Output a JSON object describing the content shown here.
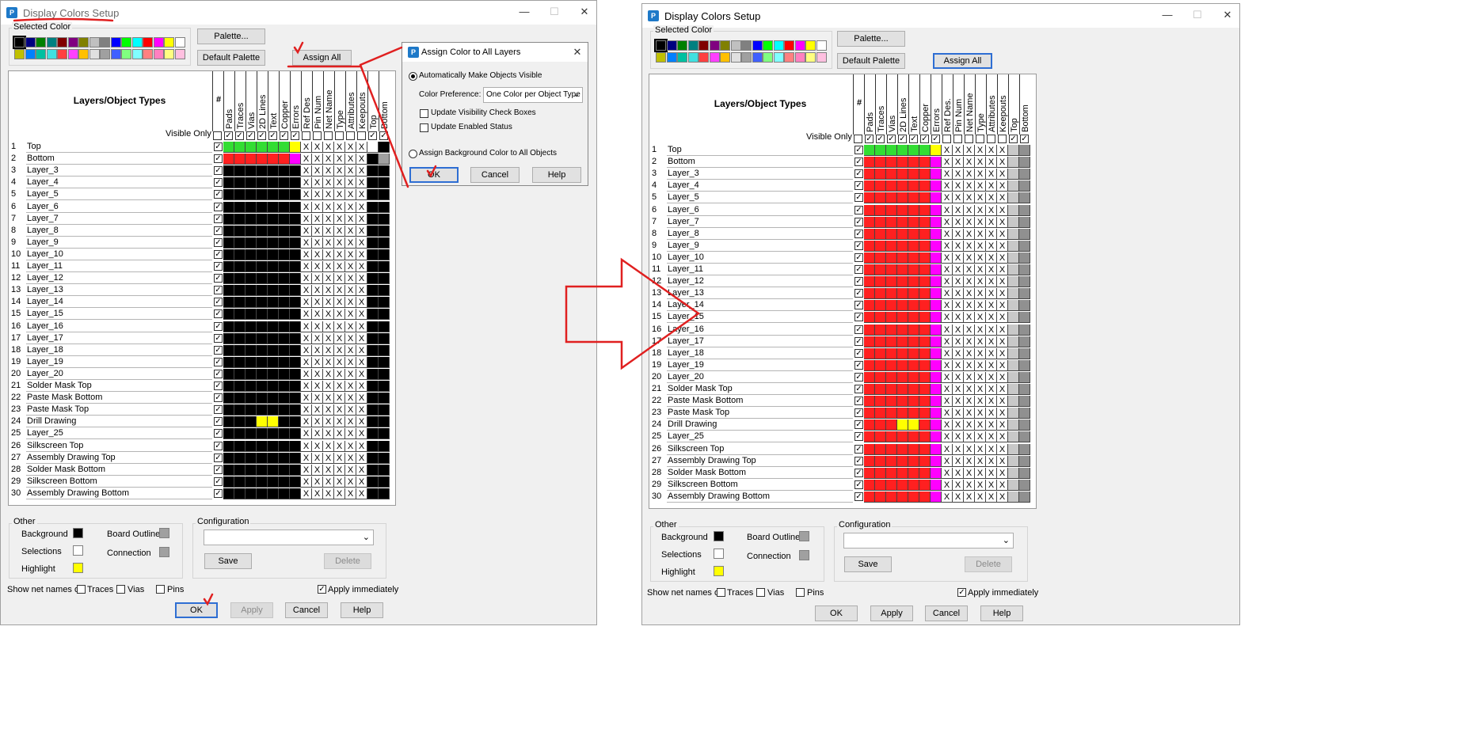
{
  "title": "Display Colors Setup",
  "selected_color_label": "Selected Color",
  "palette_btn": "Palette...",
  "default_palette_btn": "Default Palette",
  "assign_all_btn": "Assign All",
  "grid_header": "Layers/Object Types",
  "hash": "#",
  "visible_only": "Visible Only",
  "columns": [
    "Pads",
    "Traces",
    "Vias",
    "2D Lines",
    "Text",
    "Copper",
    "Errors",
    "Ref Des",
    "Pin Num",
    "Net Name",
    "Type",
    "Attributes",
    "Keepouts",
    "Top",
    "Bottom"
  ],
  "columns_right": [
    "Pads",
    "Traces",
    "Vias",
    "2D Lines",
    "Text",
    "Copper",
    "Errors",
    "Ref Des.",
    "Pin Num",
    "Net Name",
    "Type",
    "Attributes",
    "Keepouts",
    "Top",
    "Bottom"
  ],
  "rows": [
    {
      "n": "1",
      "name": "Top"
    },
    {
      "n": "2",
      "name": "Bottom"
    },
    {
      "n": "3",
      "name": "Layer_3"
    },
    {
      "n": "4",
      "name": "Layer_4"
    },
    {
      "n": "5",
      "name": "Layer_5"
    },
    {
      "n": "6",
      "name": "Layer_6"
    },
    {
      "n": "7",
      "name": "Layer_7"
    },
    {
      "n": "8",
      "name": "Layer_8"
    },
    {
      "n": "9",
      "name": "Layer_9"
    },
    {
      "n": "10",
      "name": "Layer_10"
    },
    {
      "n": "11",
      "name": "Layer_11"
    },
    {
      "n": "12",
      "name": "Layer_12"
    },
    {
      "n": "13",
      "name": "Layer_13"
    },
    {
      "n": "14",
      "name": "Layer_14"
    },
    {
      "n": "15",
      "name": "Layer_15"
    },
    {
      "n": "16",
      "name": "Layer_16"
    },
    {
      "n": "17",
      "name": "Layer_17"
    },
    {
      "n": "18",
      "name": "Layer_18"
    },
    {
      "n": "19",
      "name": "Layer_19"
    },
    {
      "n": "20",
      "name": "Layer_20"
    },
    {
      "n": "21",
      "name": "Solder Mask Top"
    },
    {
      "n": "22",
      "name": "Paste Mask Bottom"
    },
    {
      "n": "23",
      "name": "Paste Mask Top"
    },
    {
      "n": "24",
      "name": "Drill Drawing"
    },
    {
      "n": "25",
      "name": "Layer_25"
    },
    {
      "n": "26",
      "name": "Silkscreen Top"
    },
    {
      "n": "27",
      "name": "Assembly Drawing Top"
    },
    {
      "n": "28",
      "name": "Solder Mask Bottom"
    },
    {
      "n": "29",
      "name": "Silkscreen Bottom"
    },
    {
      "n": "30",
      "name": "Assembly Drawing Bottom"
    }
  ],
  "other": {
    "label": "Other",
    "background": "Background",
    "selections": "Selections",
    "highlight": "Highlight",
    "board_outline": "Board Outline",
    "connection": "Connection"
  },
  "configuration": {
    "label": "Configuration",
    "save": "Save",
    "delete": "Delete"
  },
  "net_names": {
    "label": "Show net names on",
    "traces": "Traces",
    "vias": "Vias",
    "pins": "Pins"
  },
  "apply_immediately": "Apply immediately",
  "footer": {
    "ok": "OK",
    "apply": "Apply",
    "cancel": "Cancel",
    "help": "Help"
  },
  "dialog": {
    "title": "Assign Color to All Layers",
    "auto_visible": "Automatically Make Objects Visible",
    "color_pref_label": "Color Preference:",
    "color_pref_value": "One Color per Object Type",
    "update_visibility": "Update Visibility Check Boxes",
    "update_enabled": "Update Enabled Status",
    "assign_bg": "Assign Background Color to All Objects",
    "ok": "OK",
    "cancel": "Cancel",
    "help": "Help"
  },
  "palette_colors": [
    "#000000",
    "#000080",
    "#008000",
    "#008080",
    "#800000",
    "#800080",
    "#808000",
    "#c0c0c0",
    "#808080",
    "#0000ff",
    "#00ff00",
    "#00ffff",
    "#ff0000",
    "#ff00ff",
    "#ffff00",
    "#ffffff",
    "#c0c000",
    "#0080ff",
    "#00c0a0",
    "#40e0e0",
    "#ff4040",
    "#ff40ff",
    "#ffc000",
    "#e0e0e0",
    "#a0a0a0",
    "#4060ff",
    "#80ff80",
    "#80ffff",
    "#ff8080",
    "#ff80c0",
    "#ffff80",
    "#ffc0e0"
  ],
  "colors": {
    "accent": "#2e6ed3",
    "annotation": "#e02020"
  }
}
